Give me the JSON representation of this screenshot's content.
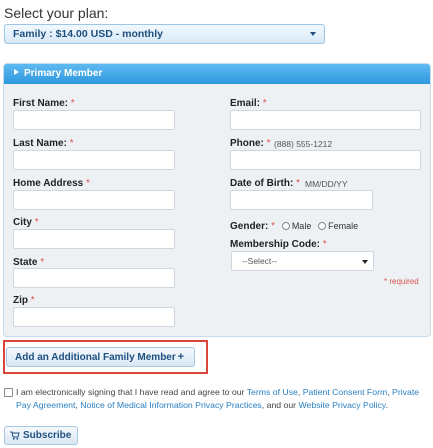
{
  "plan": {
    "heading": "Select your plan:",
    "selected": "Family : $14.00 USD - monthly"
  },
  "panel": {
    "title": "Primary Member",
    "star": "*",
    "first_name_label": "First Name:",
    "last_name_label": "Last Name:",
    "home_address_label": "Home Address",
    "city_label": "City",
    "state_label": "State",
    "zip_label": "Zip",
    "email_label": "Email:",
    "phone_label": "Phone:",
    "phone_hint": "(888) 555-1212",
    "dob_label": "Date of Birth:",
    "dob_hint": "MM/DD/YY",
    "gender_label": "Gender:",
    "gender_male": "Male",
    "gender_female": "Female",
    "membership_code_label": "Membership Code:",
    "membership_code_selected": "--Select--",
    "required_note": "* required"
  },
  "add_member_label": "Add an Additional Family Member",
  "add_member_icon": "+",
  "consent": {
    "text_before": "I am electronically signing that I have read and agree to our",
    "terms": "Terms of Use",
    "consent_form": "Patient Consent Form",
    "privacy_pay": "Private Pay Agreement",
    "notice": "Notice of Medical Information Privacy Practices",
    "and_our": ", and our",
    "website_privacy": "Website Privacy Policy",
    "period": "."
  },
  "subscribe_label": "Subscribe",
  "colors": {
    "accent": "#2e98de",
    "required": "#d9534f",
    "highlight_frame": "#d9473a",
    "link": "#2a7fc1"
  }
}
